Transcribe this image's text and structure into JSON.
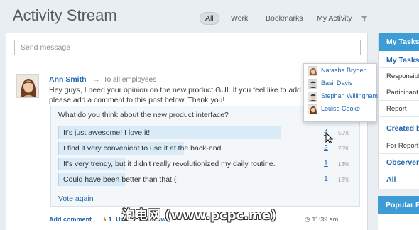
{
  "page": {
    "title": "Activity Stream"
  },
  "tabs": [
    "All",
    "Work",
    "Bookmarks",
    "My Activity"
  ],
  "send": {
    "placeholder": "Send message"
  },
  "post": {
    "author": "Ann Smith",
    "arrow": "→",
    "audience": "To all employees",
    "text": "Hey guys, I need your opinion on the new product GUI. If you feel like to add anyth... answer, please add a comment to this post below. Thank you!",
    "poll": {
      "question": "What do you think about the new product interface?",
      "options": [
        {
          "label": "It's just awesome! I love it!",
          "votes": "4",
          "percent": "50%",
          "fill": 0.87
        },
        {
          "label": "I find it very convenient to use it at the back-end.",
          "votes": "2",
          "percent": "25%",
          "fill": 0.49
        },
        {
          "label": "It's very trendy, but it didn't really revolutionized my daily routine.",
          "votes": "1",
          "percent": "13%",
          "fill": 0.26
        },
        {
          "label": "Could have been better than that:(",
          "votes": "1",
          "percent": "13%",
          "fill": 0.26
        }
      ],
      "vote_again": "Vote again"
    },
    "actions": {
      "add_comment": "Add comment",
      "like_count": "1",
      "unlike": "Unlike",
      "unfollow": "Unfollow"
    },
    "time": "11:39 am"
  },
  "voters_popup": [
    "Natasha Bryden",
    "Basil Davis",
    "Stephan Willingham",
    "Louise Cooke"
  ],
  "sidebar": {
    "header": "My Tasks",
    "rows": [
      {
        "label": "My Tasks",
        "type": "link"
      },
      {
        "label": "Responsible",
        "type": "text"
      },
      {
        "label": "Participant",
        "type": "text"
      },
      {
        "label": "Report",
        "type": "text"
      },
      {
        "label": "Created by me",
        "type": "link"
      },
      {
        "label": "For Report",
        "type": "text"
      },
      {
        "label": "Observer",
        "type": "link"
      },
      {
        "label": "All",
        "type": "link"
      }
    ],
    "popular_header": "Popular Posts"
  },
  "watermark": "泡电网 (www.pcpc.me)",
  "colors": {
    "accent": "#3d9bd5",
    "link": "#2067b0",
    "poll_fill": "#d9ebf7"
  }
}
